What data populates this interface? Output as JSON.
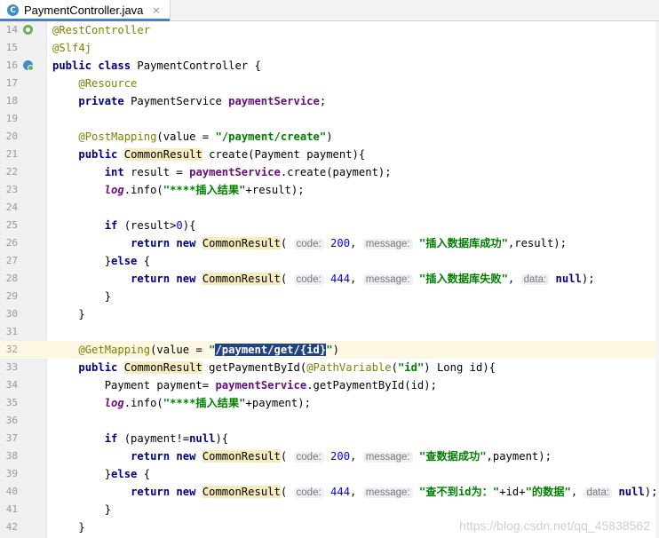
{
  "tab": {
    "label": "PaymentController.java",
    "icon": "java-class-icon",
    "close": "×"
  },
  "colors": {
    "annotation": "#808000",
    "keyword": "#000080",
    "field": "#660e7a",
    "string": "#008000",
    "number": "#0000ff",
    "hint_bg": "#edf0f4",
    "type_highlight": "#f6ebbc",
    "selection": "#214283"
  },
  "lines": [
    {
      "n": "14",
      "gicon": "spring",
      "tokens": [
        {
          "t": "@RestController",
          "c": "ann"
        }
      ]
    },
    {
      "n": "15",
      "tokens": [
        {
          "t": "@Slf4j",
          "c": "ann"
        }
      ]
    },
    {
      "n": "16",
      "gicon": "bean",
      "tokens": [
        {
          "t": "public class ",
          "c": "kw"
        },
        {
          "t": "PaymentController {"
        }
      ]
    },
    {
      "n": "17",
      "tokens": [
        {
          "t": "    "
        },
        {
          "t": "@Resource",
          "c": "ann"
        }
      ]
    },
    {
      "n": "18",
      "tokens": [
        {
          "t": "    "
        },
        {
          "t": "private ",
          "c": "kw"
        },
        {
          "t": "PaymentService "
        },
        {
          "t": "paymentService",
          "c": "fld"
        },
        {
          "t": ";"
        }
      ]
    },
    {
      "n": "19",
      "tokens": []
    },
    {
      "n": "20",
      "tokens": [
        {
          "t": "    "
        },
        {
          "t": "@PostMapping",
          "c": "ann"
        },
        {
          "t": "(value = "
        },
        {
          "t": "\"/payment/create\"",
          "c": "str"
        },
        {
          "t": ")"
        }
      ]
    },
    {
      "n": "21",
      "tokens": [
        {
          "t": "    "
        },
        {
          "t": "public ",
          "c": "kw"
        },
        {
          "t": "CommonResult",
          "c": "typ"
        },
        {
          "t": " create(Payment payment){"
        }
      ]
    },
    {
      "n": "22",
      "tokens": [
        {
          "t": "        "
        },
        {
          "t": "int ",
          "c": "kw"
        },
        {
          "t": "result = "
        },
        {
          "t": "paymentService",
          "c": "fld"
        },
        {
          "t": ".create(payment);"
        }
      ]
    },
    {
      "n": "23",
      "tokens": [
        {
          "t": "        "
        },
        {
          "t": "log",
          "c": "fldi"
        },
        {
          "t": ".info("
        },
        {
          "t": "\"****插入结果\"",
          "c": "str"
        },
        {
          "t": "+result);"
        }
      ]
    },
    {
      "n": "24",
      "tokens": []
    },
    {
      "n": "25",
      "tokens": [
        {
          "t": "        "
        },
        {
          "t": "if ",
          "c": "kw"
        },
        {
          "t": "(result>"
        },
        {
          "t": "0",
          "c": "num"
        },
        {
          "t": "){"
        }
      ]
    },
    {
      "n": "26",
      "tokens": [
        {
          "t": "            "
        },
        {
          "t": "return new ",
          "c": "kw"
        },
        {
          "t": "CommonResult",
          "c": "typ"
        },
        {
          "t": "( "
        },
        {
          "t": "code:",
          "c": "hint"
        },
        {
          "t": " "
        },
        {
          "t": "200",
          "c": "num"
        },
        {
          "t": ", "
        },
        {
          "t": "message:",
          "c": "hint"
        },
        {
          "t": " "
        },
        {
          "t": "\"插入数据库成功\"",
          "c": "str"
        },
        {
          "t": ",result);"
        }
      ]
    },
    {
      "n": "27",
      "tokens": [
        {
          "t": "        "
        },
        {
          "t": "}"
        },
        {
          "t": "else ",
          "c": "kw"
        },
        {
          "t": "{"
        }
      ]
    },
    {
      "n": "28",
      "tokens": [
        {
          "t": "            "
        },
        {
          "t": "return new ",
          "c": "kw"
        },
        {
          "t": "CommonResult",
          "c": "typ"
        },
        {
          "t": "( "
        },
        {
          "t": "code:",
          "c": "hint"
        },
        {
          "t": " "
        },
        {
          "t": "444",
          "c": "num"
        },
        {
          "t": ", "
        },
        {
          "t": "message:",
          "c": "hint"
        },
        {
          "t": " "
        },
        {
          "t": "\"插入数据库失败\"",
          "c": "str"
        },
        {
          "t": ", "
        },
        {
          "t": "data:",
          "c": "hint"
        },
        {
          "t": " "
        },
        {
          "t": "null",
          "c": "kw"
        },
        {
          "t": ");"
        }
      ]
    },
    {
      "n": "29",
      "tokens": [
        {
          "t": "        }"
        }
      ]
    },
    {
      "n": "30",
      "tokens": [
        {
          "t": "    }"
        }
      ]
    },
    {
      "n": "31",
      "tokens": []
    },
    {
      "n": "32",
      "current": true,
      "tokens": [
        {
          "t": "    "
        },
        {
          "t": "@GetMapping",
          "c": "ann"
        },
        {
          "t": "(value = "
        },
        {
          "t": "\"",
          "c": "str"
        },
        {
          "t": "/payment/get/{id}",
          "c": "sel"
        },
        {
          "t": "\"",
          "c": "str"
        },
        {
          "t": ")"
        }
      ]
    },
    {
      "n": "33",
      "tokens": [
        {
          "t": "    "
        },
        {
          "t": "public ",
          "c": "kw"
        },
        {
          "t": "CommonResult",
          "c": "typ"
        },
        {
          "t": " getPaymentById("
        },
        {
          "t": "@PathVariable",
          "c": "ann"
        },
        {
          "t": "("
        },
        {
          "t": "\"id\"",
          "c": "str"
        },
        {
          "t": ") Long id){"
        }
      ]
    },
    {
      "n": "34",
      "tokens": [
        {
          "t": "        "
        },
        {
          "t": "Payment payment= "
        },
        {
          "t": "paymentService",
          "c": "fld"
        },
        {
          "t": ".getPaymentById(id);"
        }
      ]
    },
    {
      "n": "35",
      "tokens": [
        {
          "t": "        "
        },
        {
          "t": "log",
          "c": "fldi"
        },
        {
          "t": ".info("
        },
        {
          "t": "\"****插入结果\"",
          "c": "str"
        },
        {
          "t": "+payment);"
        }
      ]
    },
    {
      "n": "36",
      "tokens": []
    },
    {
      "n": "37",
      "tokens": [
        {
          "t": "        "
        },
        {
          "t": "if ",
          "c": "kw"
        },
        {
          "t": "(payment!="
        },
        {
          "t": "null",
          "c": "kw"
        },
        {
          "t": "){"
        }
      ]
    },
    {
      "n": "38",
      "tokens": [
        {
          "t": "            "
        },
        {
          "t": "return new ",
          "c": "kw"
        },
        {
          "t": "CommonResult",
          "c": "typ"
        },
        {
          "t": "( "
        },
        {
          "t": "code:",
          "c": "hint"
        },
        {
          "t": " "
        },
        {
          "t": "200",
          "c": "num"
        },
        {
          "t": ", "
        },
        {
          "t": "message:",
          "c": "hint"
        },
        {
          "t": " "
        },
        {
          "t": "\"查数据成功\"",
          "c": "str"
        },
        {
          "t": ",payment);"
        }
      ]
    },
    {
      "n": "39",
      "tokens": [
        {
          "t": "        "
        },
        {
          "t": "}"
        },
        {
          "t": "else ",
          "c": "kw"
        },
        {
          "t": "{"
        }
      ]
    },
    {
      "n": "40",
      "tokens": [
        {
          "t": "            "
        },
        {
          "t": "return new ",
          "c": "kw"
        },
        {
          "t": "CommonResult",
          "c": "typ"
        },
        {
          "t": "( "
        },
        {
          "t": "code:",
          "c": "hint"
        },
        {
          "t": " "
        },
        {
          "t": "444",
          "c": "num"
        },
        {
          "t": ", "
        },
        {
          "t": "message:",
          "c": "hint"
        },
        {
          "t": " "
        },
        {
          "t": "\"查不到id为：\"",
          "c": "str"
        },
        {
          "t": "+id+"
        },
        {
          "t": "\"的数据\"",
          "c": "str"
        },
        {
          "t": ", "
        },
        {
          "t": "data:",
          "c": "hint"
        },
        {
          "t": " "
        },
        {
          "t": "null",
          "c": "kw"
        },
        {
          "t": ");"
        }
      ]
    },
    {
      "n": "41",
      "tokens": [
        {
          "t": "        }"
        }
      ]
    },
    {
      "n": "42",
      "tokens": [
        {
          "t": "    }"
        }
      ]
    }
  ],
  "watermark": "https://blog.csdn.net/qq_45838562"
}
